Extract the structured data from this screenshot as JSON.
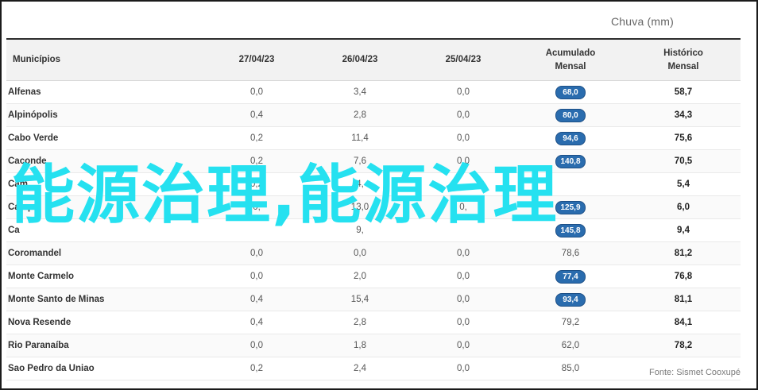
{
  "caption": "Chuva (mm)",
  "headers": {
    "municipios": "Municípios",
    "d1": "27/04/23",
    "d2": "26/04/23",
    "d3": "25/04/23",
    "acumulado_l1": "Acumulado",
    "acumulado_l2": "Mensal",
    "historico_l1": "Histórico",
    "historico_l2": "Mensal"
  },
  "rows": [
    {
      "name": "Alfenas",
      "d1": "0,0",
      "d2": "3,4",
      "d3": "0,0",
      "acc": "68,0",
      "hi": true,
      "hist": "58,7"
    },
    {
      "name": "Alpinópolis",
      "d1": "0,4",
      "d2": "2,8",
      "d3": "0,0",
      "acc": "80,0",
      "hi": true,
      "hist": "34,3"
    },
    {
      "name": "Cabo Verde",
      "d1": "0,2",
      "d2": "11,4",
      "d3": "0,0",
      "acc": "94,6",
      "hi": true,
      "hist": "75,6"
    },
    {
      "name": "Caconde",
      "d1": "0,2",
      "d2": "7,6",
      "d3": "0,0",
      "acc": "140,8",
      "hi": true,
      "hist": "70,5"
    },
    {
      "name": "Cam",
      "d1": "0,2",
      "d2": "4,",
      "d3": "",
      "acc": "",
      "hi": false,
      "hist": "5,4"
    },
    {
      "name": "Camp",
      "d1": "0,",
      "d2": "13,0",
      "d3": "0,",
      "acc": "125,9",
      "hi": true,
      "hist": "6,0"
    },
    {
      "name": "Ca",
      "d1": "",
      "d2": "9,",
      "d3": "",
      "acc": "145,8",
      "hi": true,
      "hist": "9,4"
    },
    {
      "name": "Coromandel",
      "d1": "0,0",
      "d2": "0,0",
      "d3": "0,0",
      "acc": "78,6",
      "hi": false,
      "hist": "81,2"
    },
    {
      "name": "Monte Carmelo",
      "d1": "0,0",
      "d2": "2,0",
      "d3": "0,0",
      "acc": "77,4",
      "hi": true,
      "hist": "76,8"
    },
    {
      "name": "Monte Santo de Minas",
      "d1": "0,4",
      "d2": "15,4",
      "d3": "0,0",
      "acc": "93,4",
      "hi": true,
      "hist": "81,1"
    },
    {
      "name": "Nova Resende",
      "d1": "0,4",
      "d2": "2,8",
      "d3": "0,0",
      "acc": "79,2",
      "hi": false,
      "hist": "84,1"
    },
    {
      "name": "Rio Paranaíba",
      "d1": "0,0",
      "d2": "1,8",
      "d3": "0,0",
      "acc": "62,0",
      "hi": false,
      "hist": "78,2"
    },
    {
      "name": "Sao Pedro da Uniao",
      "d1": "0,2",
      "d2": "2,4",
      "d3": "0,0",
      "acc": "85,0",
      "hi": false,
      "hist": ""
    }
  ],
  "source": "Fonte: Sismet Cooxupé",
  "overlay_text": "能源治理,能源治理",
  "colors": {
    "pill": "#2a6cae",
    "overlay": "#25e1f0"
  }
}
